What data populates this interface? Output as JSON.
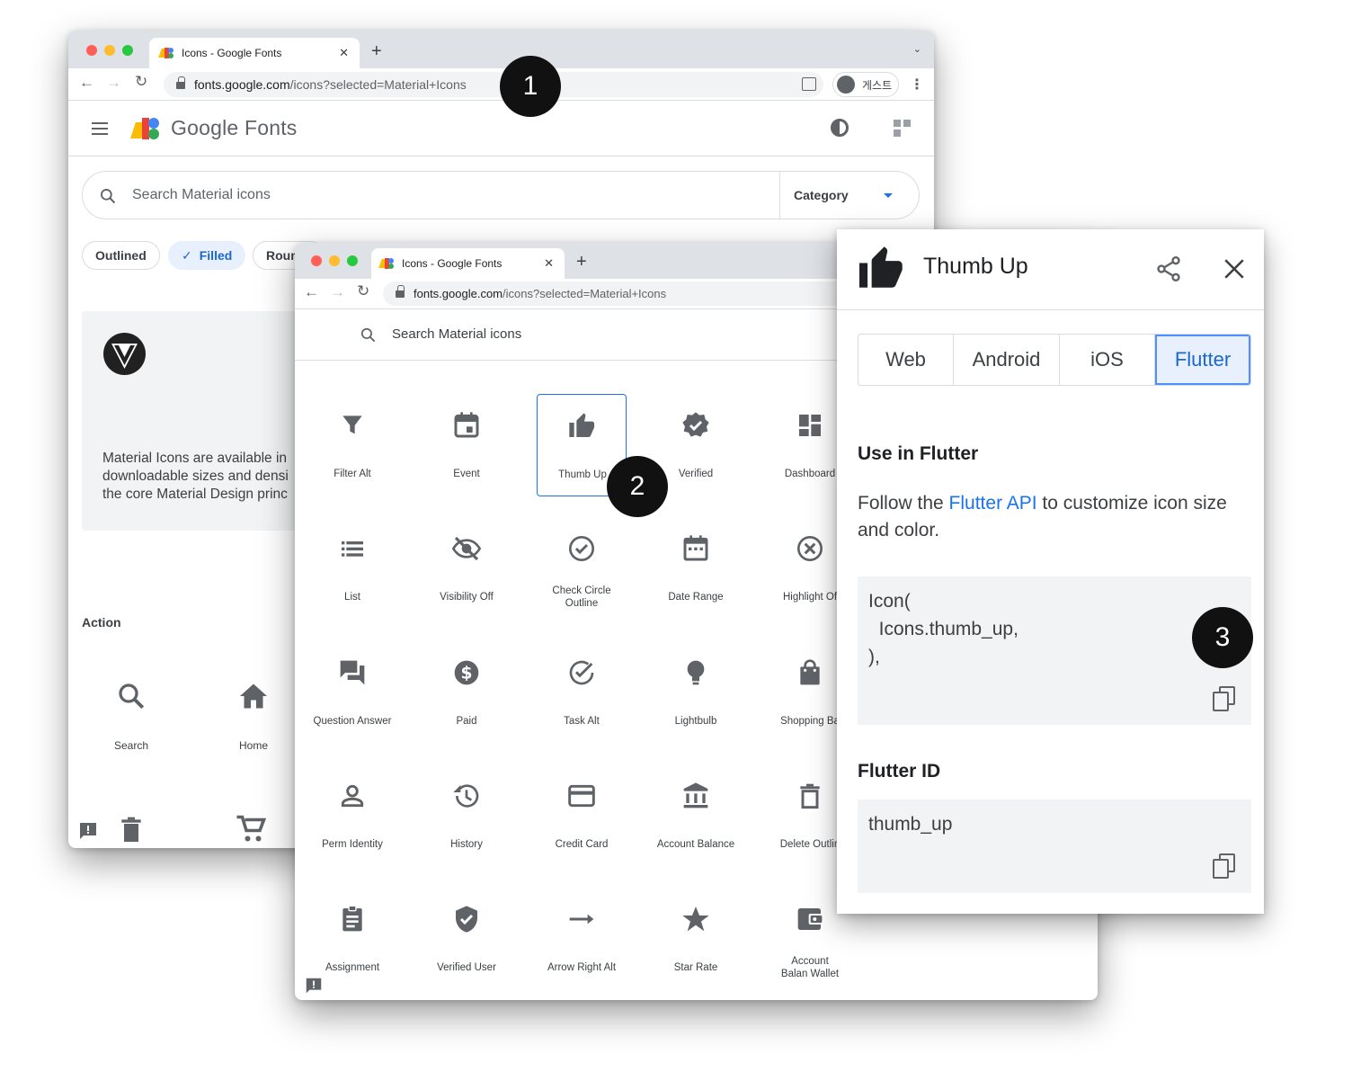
{
  "back_window": {
    "tab_title": "Icons - Google Fonts",
    "url_host": "fonts.google.com",
    "url_path": "/icons?selected=Material+Icons",
    "profile_label": "게스트",
    "site_name": "Google Fonts",
    "search_placeholder": "Search Material icons",
    "category_label": "Category",
    "chips": [
      "Outlined",
      "Filled",
      "Roun"
    ],
    "info_text": [
      "Material Icons are available in",
      "downloadable sizes and densi",
      "the core Material Design princ"
    ],
    "section_title": "Action",
    "action_icons": [
      {
        "label": "Search",
        "icon": "search-icon"
      },
      {
        "label": "Home",
        "icon": "home-icon"
      }
    ]
  },
  "front_window": {
    "tab_title": "Icons - Google Fonts",
    "url_host": "fonts.google.com",
    "url_path": "/icons?selected=Material+Icons",
    "search_placeholder": "Search Material icons",
    "icons": [
      [
        "Filter Alt",
        "Event",
        "Thumb Up",
        "Verified",
        "Dashboard"
      ],
      [
        "List",
        "Visibility Off",
        "Check Circle Outline",
        "Date Range",
        "Highlight Of"
      ],
      [
        "Question Answer",
        "Paid",
        "Task Alt",
        "Lightbulb",
        "Shopping Ba"
      ],
      [
        "Perm Identity",
        "History",
        "Credit Card",
        "Account Balance",
        "Delete Outlin"
      ],
      [
        "Assignment",
        "Verified User",
        "Arrow Right Alt",
        "Star Rate",
        "Account Balan Wallet"
      ]
    ],
    "selected_icon": "Thumb Up"
  },
  "side_panel": {
    "title": "Thumb Up",
    "platforms": [
      "Web",
      "Android",
      "iOS",
      "Flutter"
    ],
    "active_platform": "Flutter",
    "use_heading": "Use in Flutter",
    "desc_prefix": "Follow the ",
    "desc_link": "Flutter API",
    "desc_suffix": " to customize icon size and color.",
    "code_lines": [
      "Icon(",
      "  Icons.thumb_up,",
      "),"
    ],
    "id_heading": "Flutter ID",
    "id_value": "thumb_up"
  },
  "callouts": [
    "1",
    "2",
    "3"
  ],
  "colors": {
    "accent": "#1a73e8",
    "selected_bg": "#e8f0fe",
    "icon_gray": "#5f6368",
    "code_bg": "#f1f3f4"
  }
}
